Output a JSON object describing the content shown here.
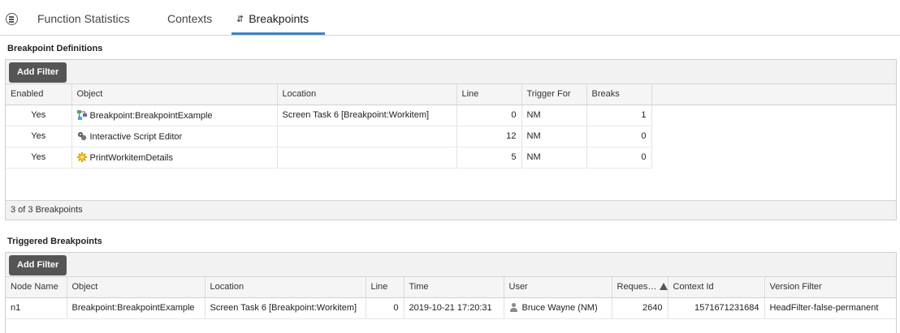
{
  "tabs": [
    {
      "label": "Function Statistics",
      "active": false
    },
    {
      "label": "Contexts",
      "active": false
    },
    {
      "label": "Breakpoints",
      "active": true,
      "icon": "refresh-icon"
    }
  ],
  "definitions": {
    "title": "Breakpoint Definitions",
    "add_filter_label": "Add Filter",
    "columns": [
      "Enabled",
      "Object",
      "Location",
      "Line",
      "Trigger For",
      "Breaks"
    ],
    "rows": [
      {
        "enabled": "Yes",
        "object": "Breakpoint:BreakpointExample",
        "object_icon": "screen-flow-icon",
        "location": "Screen Task 6 [Breakpoint:Workitem]",
        "line": "0",
        "trigger_for": "NM",
        "breaks": "1"
      },
      {
        "enabled": "Yes",
        "object": "Interactive Script Editor",
        "object_icon": "script-editor-icon",
        "location": "",
        "line": "12",
        "trigger_for": "NM",
        "breaks": "0"
      },
      {
        "enabled": "Yes",
        "object": "PrintWorkitemDetails",
        "object_icon": "gear-function-icon",
        "location": "",
        "line": "5",
        "trigger_for": "NM",
        "breaks": "0"
      }
    ],
    "footer": "3 of 3 Breakpoints"
  },
  "triggered": {
    "title": "Triggered Breakpoints",
    "add_filter_label": "Add Filter",
    "columns": [
      "Node Name",
      "Object",
      "Location",
      "Line",
      "Time",
      "User",
      "Reques…",
      "Context Id",
      "Version Filter"
    ],
    "sorted_column": "Reques…",
    "sort_direction": "ascending",
    "rows": [
      {
        "node_name": "n1",
        "object": "Breakpoint:BreakpointExample",
        "location": "Screen Task 6 [Breakpoint:Workitem]",
        "line": "0",
        "time": "2019-10-21 17:20:31",
        "user": "Bruce Wayne (NM)",
        "request": "2640",
        "context_id": "1571671231684",
        "version_filter": "HeadFilter-false-permanent"
      }
    ]
  },
  "colors": {
    "accent": "#3d82c4",
    "button_bg": "#555555"
  }
}
